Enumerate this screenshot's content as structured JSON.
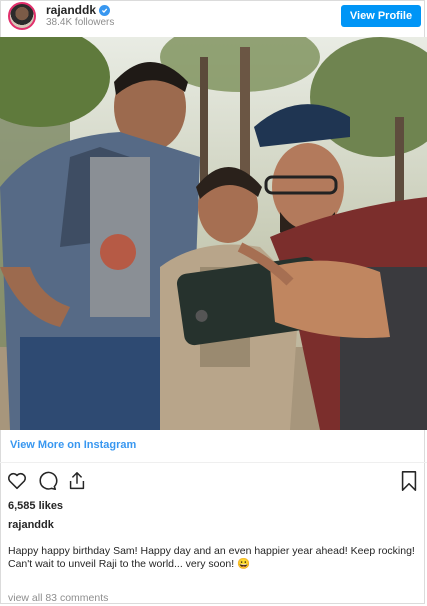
{
  "header": {
    "username": "rajanddk",
    "followers": "38.4K followers",
    "view_profile_label": "View Profile",
    "verified_icon": "verified-badge-icon"
  },
  "post": {
    "image_icon": "selfie-photo",
    "view_more_label": "View More on Instagram",
    "icons": [
      "heart-icon",
      "comment-icon",
      "share-icon",
      "bookmark-icon"
    ],
    "likes": "6,585 likes",
    "author": "rajanddk",
    "caption_line1": "Happy happy birthday Sam! Happy day and an even happier year ahead! Keep rocking!",
    "caption_line2": "Can't wait to unveil Raji to the world... very soon! 😀",
    "view_comments_label": "view all 83 comments"
  },
  "colors": {
    "accent": "#3897f0",
    "button": "#0095f6",
    "muted": "#8e8e8e"
  }
}
